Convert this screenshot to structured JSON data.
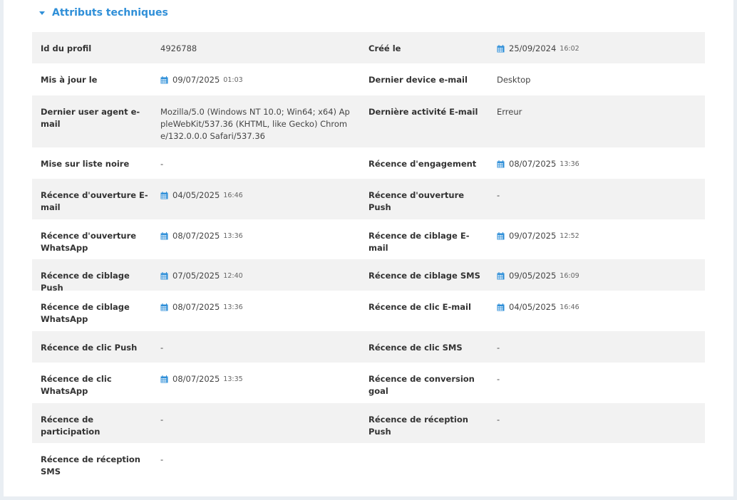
{
  "section": {
    "title": "Attributs techniques",
    "accent_color": "#2f8fd8"
  },
  "rows": [
    {
      "height": 44,
      "striped": true,
      "left": {
        "label": "Id du profil",
        "value": "4926788"
      },
      "right": {
        "label": "Créé le",
        "date": "25/09/2024",
        "time": "16:02"
      }
    },
    {
      "height": 45,
      "striped": false,
      "left": {
        "label": "Mis à jour le",
        "date": "09/07/2025",
        "time": "01:03"
      },
      "right": {
        "label": "Dernier device e-mail",
        "value": "Desktop"
      }
    },
    {
      "height": 73,
      "striped": true,
      "left": {
        "label": "Dernier user agent e-mail",
        "value": "Mozilla/5.0 (Windows NT 10.0; Win64; x64) AppleWebKit/537.36 (KHTML, like Gecko) Chrome/132.0.0.0 Safari/537.36"
      },
      "right": {
        "label": "Dernière activité E-mail",
        "value": "Erreur"
      }
    },
    {
      "height": 44,
      "striped": false,
      "left": {
        "label": "Mise sur liste noire",
        "value": "-"
      },
      "right": {
        "label": "Récence d'engagement",
        "date": "08/07/2025",
        "time": "13:36"
      }
    },
    {
      "height": 57,
      "striped": true,
      "left": {
        "label": "Récence d'ouverture E-mail",
        "date": "04/05/2025",
        "time": "16:46"
      },
      "right": {
        "label": "Récence d'ouverture Push",
        "value": "-"
      }
    },
    {
      "height": 56,
      "striped": false,
      "left": {
        "label": "Récence d'ouverture WhatsApp",
        "date": "08/07/2025",
        "time": "13:36"
      },
      "right": {
        "label": "Récence de ciblage E-mail",
        "date": "09/07/2025",
        "time": "12:52"
      }
    },
    {
      "height": 44,
      "striped": true,
      "left": {
        "label": "Récence de ciblage Push",
        "date": "07/05/2025",
        "time": "12:40"
      },
      "right": {
        "label": "Récence de ciblage SMS",
        "date": "09/05/2025",
        "time": "16:09"
      }
    },
    {
      "height": 57,
      "striped": false,
      "left": {
        "label": "Récence de ciblage WhatsApp",
        "date": "08/07/2025",
        "time": "13:36"
      },
      "right": {
        "label": "Récence de clic E-mail",
        "date": "04/05/2025",
        "time": "16:46"
      }
    },
    {
      "height": 44,
      "striped": true,
      "left": {
        "label": "Récence de clic Push",
        "value": "-"
      },
      "right": {
        "label": "Récence de clic SMS",
        "value": "-"
      }
    },
    {
      "height": 57,
      "striped": false,
      "left": {
        "label": "Récence de clic WhatsApp",
        "date": "08/07/2025",
        "time": "13:35"
      },
      "right": {
        "label": "Récence de conversion goal",
        "value": "-"
      }
    },
    {
      "height": 56,
      "striped": true,
      "left": {
        "label": "Récence de participation",
        "value": "-"
      },
      "right": {
        "label": "Récence de réception Push",
        "value": "-"
      }
    },
    {
      "height": 56,
      "striped": false,
      "left": {
        "label": "Récence de réception SMS",
        "value": "-"
      },
      "right": null
    }
  ]
}
